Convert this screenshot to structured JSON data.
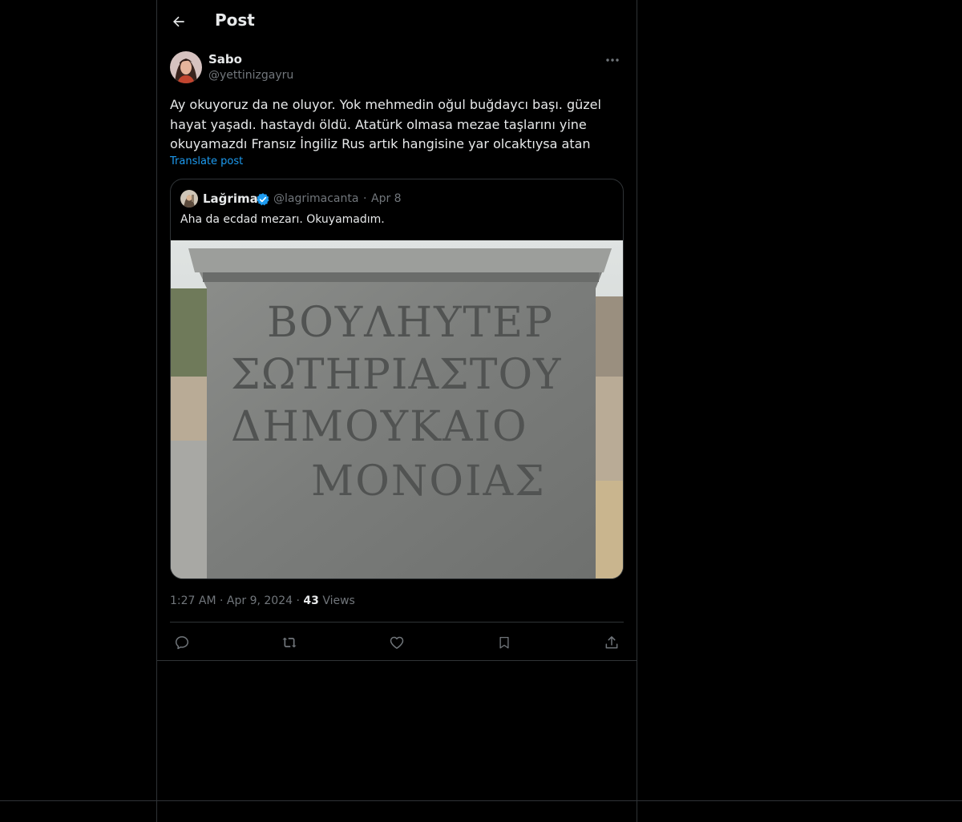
{
  "header": {
    "title": "Post"
  },
  "post": {
    "author": {
      "name": "Sabo",
      "handle": "@yettinizgayru"
    },
    "text": "Ay okuyoruz da ne oluyor. Yok mehmedin oğul buğdaycı başı. güzel hayat yaşadı. hastaydı öldü. Atatürk olmasa mezae taşlarını yine okuyamazdı Fransız İngiliz Rus artık hangisine yar olcaktıysa atan",
    "translate_label": "Translate post",
    "time": "1:27 AM",
    "date": "Apr 9, 2024",
    "views_count": "43",
    "views_label": "Views"
  },
  "quote": {
    "name": "Lağrima",
    "handle": "@lagrimacanta",
    "date": "Apr 8",
    "text": "Aha da ecdad mezarı. Okuyamadım.",
    "inscription_lines": [
      "ΒΟΥΛΗΥΤΕΡ",
      "ΣΩΤΗΡΙΑΣΤΟΥ",
      "ΔΗΜΟΥΚΑΙΟ",
      "ΜΟΝΟΙΑΣ"
    ]
  },
  "separator": "·",
  "icons": {
    "back": "arrow-left-icon",
    "more": "more-horizontal-icon",
    "verified": "verified-badge-icon",
    "reply": "reply-icon",
    "repost": "repost-icon",
    "like": "like-icon",
    "bookmark": "bookmark-icon",
    "share": "share-icon"
  },
  "colors": {
    "background": "#000000",
    "text": "#e7e9ea",
    "muted": "#71767b",
    "accent": "#1d9bf0",
    "border": "#2f3336"
  }
}
